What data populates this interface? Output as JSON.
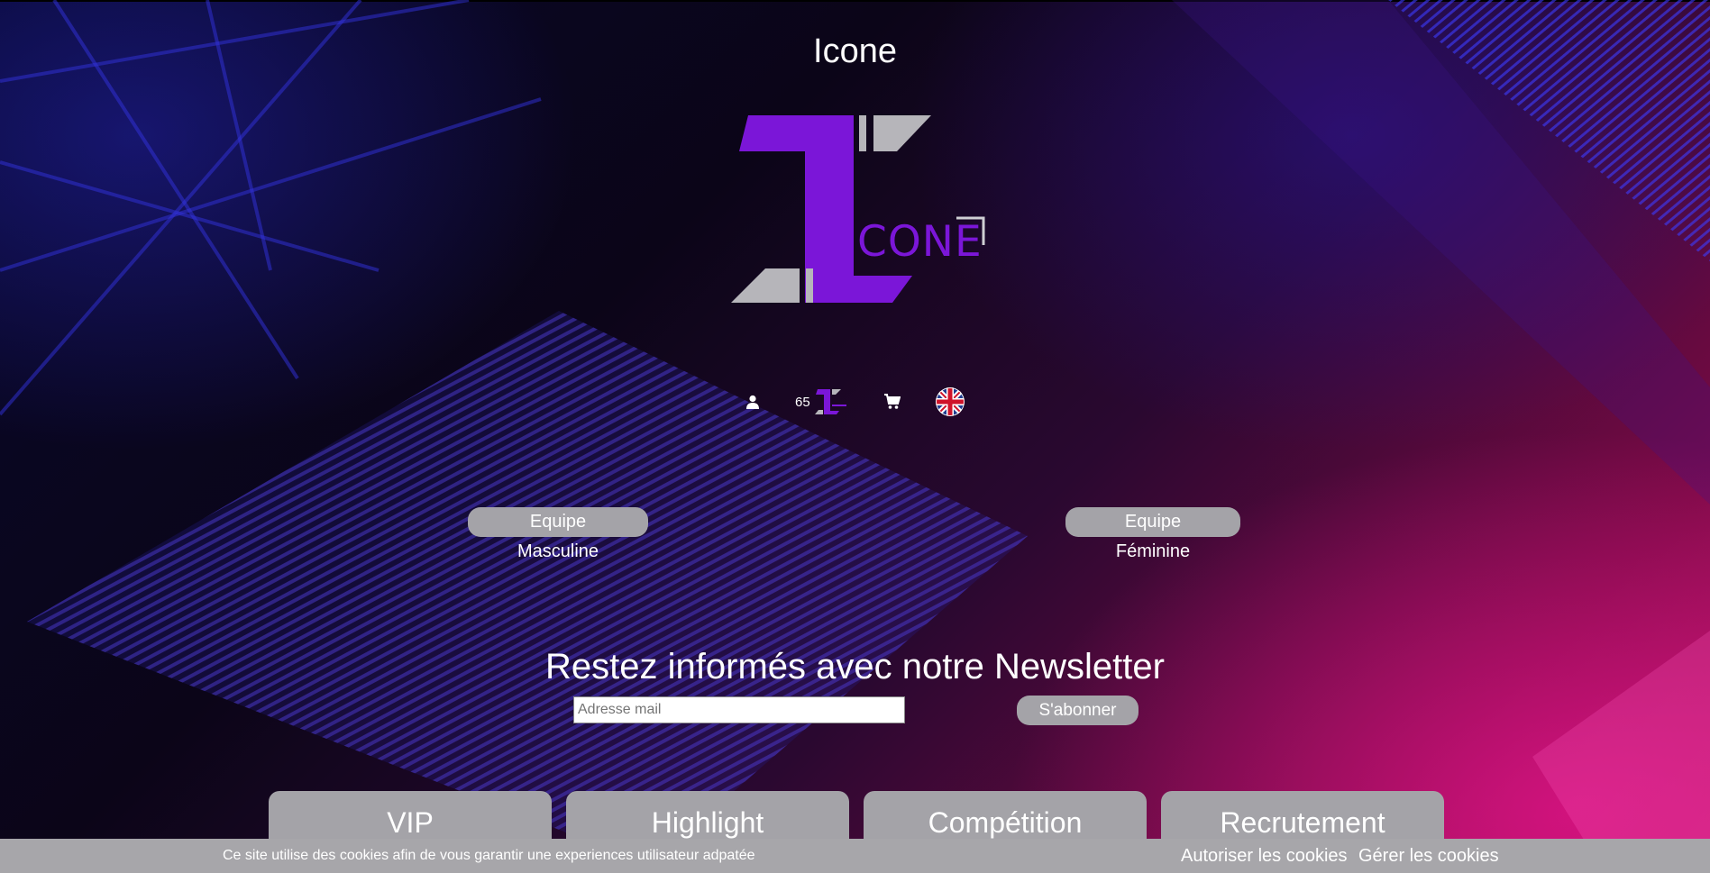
{
  "site": {
    "title": "Icone"
  },
  "logo": {
    "wordmark": "CONE"
  },
  "iconbar": {
    "user_icon": "user-icon",
    "credits": {
      "count": "65",
      "icon": "icone-coin-icon"
    },
    "cart_icon": "cart-icon",
    "language_icon": "uk-flag-icon"
  },
  "teams": {
    "male_label": "Equipe Masculine",
    "female_label": "Equipe Féminine"
  },
  "newsletter": {
    "title": "Restez informés avec notre Newsletter",
    "placeholder": "Adresse mail",
    "button_label": "S'abonner"
  },
  "cards": [
    {
      "label": "VIP"
    },
    {
      "label": "Highlight"
    },
    {
      "label": "Compétition"
    },
    {
      "label": "Recrutement"
    }
  ],
  "cookie": {
    "text": "Ce site utilise des cookies afin de vous garantir une experiences utilisateur adpatée",
    "allow_label": "Autoriser les cookies",
    "manage_label": "Gérer les cookies"
  },
  "colors": {
    "brand_purple": "#7b16d8",
    "logo_gray": "#b6b5ba",
    "button_gray": "#a4a3a8"
  }
}
